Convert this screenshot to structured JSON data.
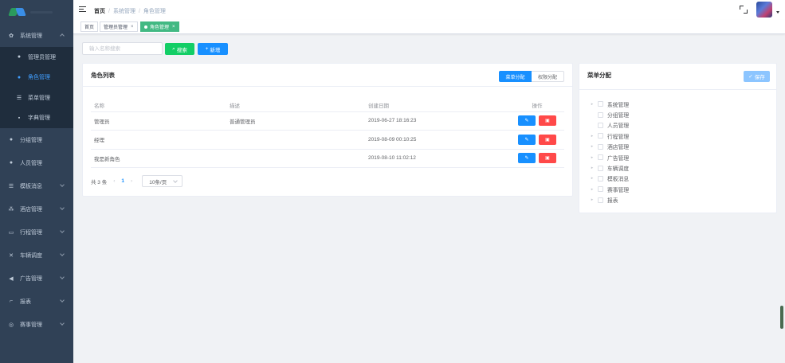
{
  "breadcrumb": [
    "首页",
    "系统管理",
    "角色管理"
  ],
  "sidebar": {
    "items": [
      {
        "label": "系统管理",
        "icon": "gear-icon",
        "open": true,
        "children": [
          {
            "label": "管理员管理",
            "icon": "user-icon",
            "active": false
          },
          {
            "label": "角色管理",
            "icon": "user-icon",
            "active": true
          },
          {
            "label": "菜单管理",
            "icon": "list-icon",
            "active": false
          },
          {
            "label": "字典管理",
            "icon": "book-icon",
            "active": false
          }
        ]
      },
      {
        "label": "分组管理",
        "icon": "user-icon"
      },
      {
        "label": "人员管理",
        "icon": "user-icon"
      },
      {
        "label": "模板消息",
        "icon": "list-icon"
      },
      {
        "label": "酒店管理",
        "icon": "tree-icon"
      },
      {
        "label": "行程管理",
        "icon": "calendar-icon"
      },
      {
        "label": "车辆调度",
        "icon": "tools-icon"
      },
      {
        "label": "广告管理",
        "icon": "megaphone-icon"
      },
      {
        "label": "报表",
        "icon": "chart-icon"
      },
      {
        "label": "赛事管理",
        "icon": "trophy-icon"
      }
    ]
  },
  "tags": [
    {
      "label": "首页",
      "closable": false,
      "active": false
    },
    {
      "label": "管理员管理",
      "closable": true,
      "active": false
    },
    {
      "label": "角色管理",
      "closable": true,
      "active": true
    }
  ],
  "search": {
    "placeholder": "输入名称搜索",
    "search_label": "搜索",
    "add_label": "新增"
  },
  "role_list": {
    "title": "角色列表",
    "toggle": [
      "菜单分配",
      "权限分配"
    ],
    "columns": [
      "名称",
      "描述",
      "创建日期",
      "操作"
    ],
    "rows": [
      {
        "name": "管理员",
        "desc": "普通管理员",
        "date": "2019-06-27 18:16:23"
      },
      {
        "name": "经理",
        "desc": "",
        "date": "2019-08-09 00:10:25"
      },
      {
        "name": "我是新角色",
        "desc": "",
        "date": "2019-08-10 11:02:12"
      }
    ],
    "pager": {
      "total_label": "共 3 条",
      "current": "1",
      "size_label": "10条/页"
    }
  },
  "menu_assign": {
    "title": "菜单分配",
    "save_label": "保存",
    "tree": [
      {
        "label": "系统管理",
        "expandable": true
      },
      {
        "label": "分组管理",
        "expandable": false
      },
      {
        "label": "人员管理",
        "expandable": false
      },
      {
        "label": "行程管理",
        "expandable": true
      },
      {
        "label": "酒店管理",
        "expandable": true
      },
      {
        "label": "广告管理",
        "expandable": true
      },
      {
        "label": "车辆调度",
        "expandable": true
      },
      {
        "label": "模板消息",
        "expandable": true
      },
      {
        "label": "赛事管理",
        "expandable": true
      },
      {
        "label": "报表",
        "expandable": true
      }
    ]
  },
  "colors": {
    "sidebar_bg": "#304156",
    "primary": "#1890ff",
    "success": "#13ce66",
    "danger": "#ff4949",
    "tag_active": "#42b983"
  }
}
